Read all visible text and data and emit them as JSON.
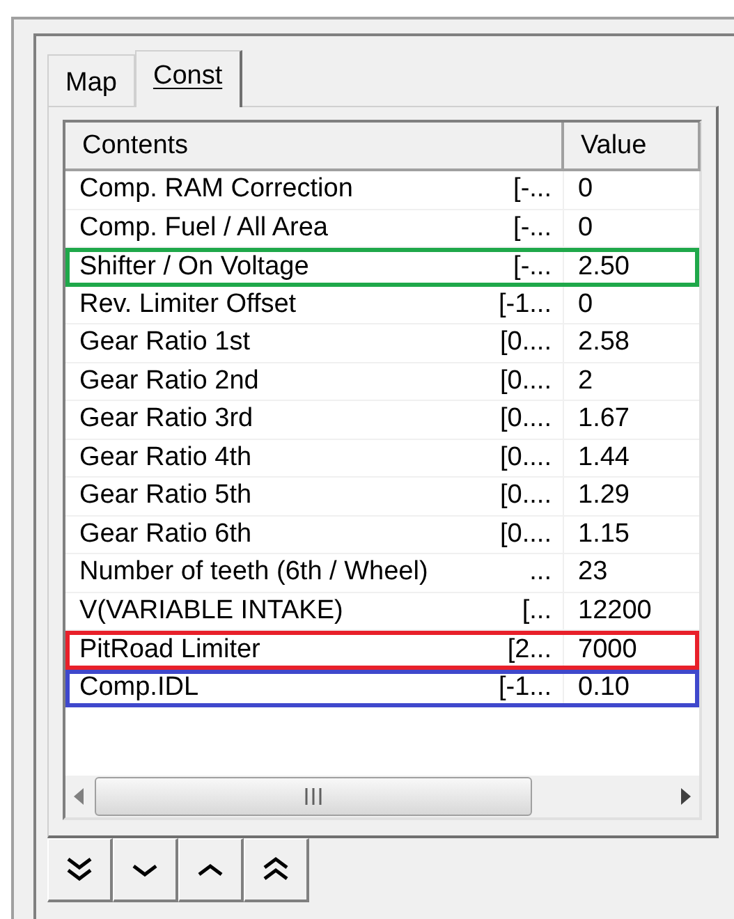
{
  "tabs": [
    {
      "label": "Map",
      "selected": false
    },
    {
      "label": "Const",
      "selected": true
    }
  ],
  "table": {
    "columns": [
      "Contents",
      "Value"
    ],
    "rows": [
      {
        "name": "Comp. RAM Correction",
        "range": "[-...",
        "value": "0"
      },
      {
        "name": "Comp. Fuel / All Area",
        "range": "[-...",
        "value": "0"
      },
      {
        "name": "Shifter / On Voltage",
        "range": "[-...",
        "value": "2.50",
        "color": "#1fa84a"
      },
      {
        "name": "Rev. Limiter Offset",
        "range": "[-1...",
        "value": "0"
      },
      {
        "name": "Gear Ratio 1st",
        "range": "[0....",
        "value": "2.58"
      },
      {
        "name": "Gear Ratio 2nd",
        "range": "[0....",
        "value": "2"
      },
      {
        "name": "Gear Ratio 3rd",
        "range": "[0....",
        "value": "1.67"
      },
      {
        "name": "Gear Ratio 4th",
        "range": "[0....",
        "value": "1.44"
      },
      {
        "name": "Gear Ratio 5th",
        "range": "[0....",
        "value": "1.29"
      },
      {
        "name": "Gear Ratio 6th",
        "range": "[0....",
        "value": "1.15"
      },
      {
        "name": "Number of teeth (6th / Wheel)",
        "range": "...",
        "value": "23"
      },
      {
        "name": "V(VARIABLE INTAKE)",
        "range": "[...",
        "value": "12200"
      },
      {
        "name": "PitRoad Limiter",
        "range": "[2...",
        "value": "7000",
        "color": "#e8202a"
      },
      {
        "name": "Comp.IDL",
        "range": "[-1...",
        "value": "0.10",
        "color": "#3f48cc"
      }
    ]
  },
  "buttons": [
    {
      "kind": "bottom"
    },
    {
      "kind": "down"
    },
    {
      "kind": "up"
    },
    {
      "kind": "top"
    }
  ]
}
